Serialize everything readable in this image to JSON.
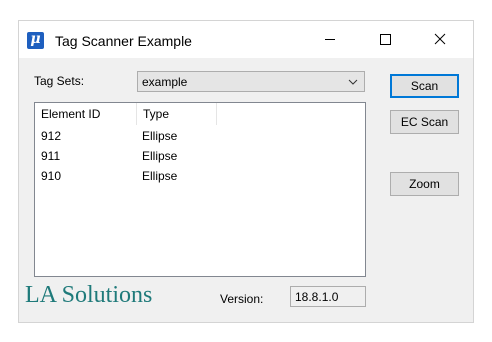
{
  "window": {
    "title": "Tag Scanner Example",
    "icon": "mu-icon",
    "controls": [
      "minimize",
      "maximize",
      "close"
    ]
  },
  "tag_sets": {
    "label": "Tag Sets:",
    "selected": "example"
  },
  "list": {
    "columns": [
      "Element ID",
      "Type"
    ],
    "rows": [
      {
        "id": "912",
        "type": "Ellipse"
      },
      {
        "id": "911",
        "type": "Ellipse"
      },
      {
        "id": "910",
        "type": "Ellipse"
      }
    ]
  },
  "buttons": {
    "scan": "Scan",
    "ec_scan": "EC Scan",
    "zoom": "Zoom"
  },
  "footer": {
    "brand": "LA Solutions",
    "version_label": "Version:",
    "version_value": "18.8.1.0"
  },
  "colors": {
    "brand": "#1f7a7a",
    "default_button_border": "#0078d7",
    "app_icon": "#1e5fbf"
  }
}
